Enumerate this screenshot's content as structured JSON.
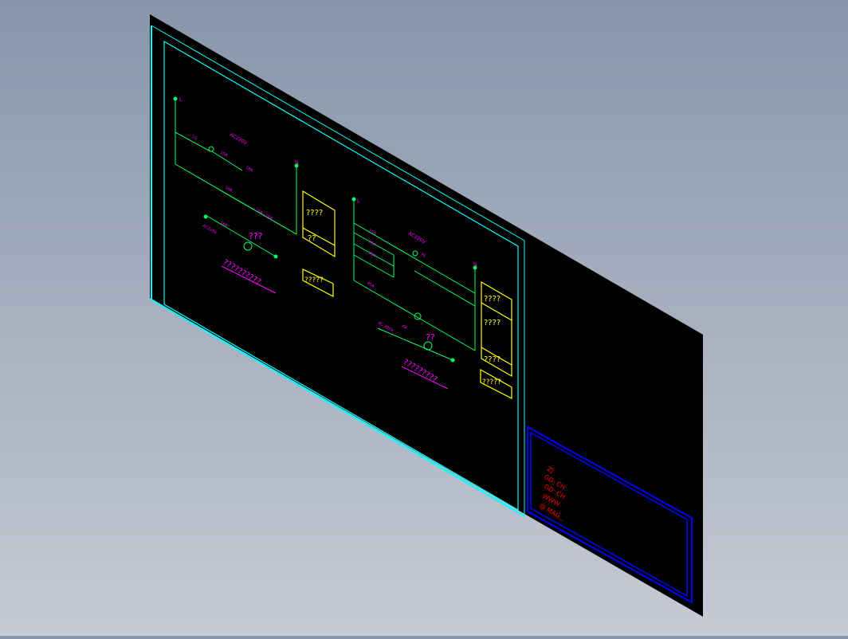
{
  "viewport": {
    "background_top": "#8796aa",
    "background_bottom": "#c6cad3",
    "sheet_color": "#000000"
  },
  "colors": {
    "frame": "#00ffff",
    "wire": "#00ff66",
    "label": "#ff00ff",
    "box": "#ffff00",
    "title_block": "#0000ff",
    "title_text": "#ff0000"
  },
  "left_circuit": {
    "phase_label": "L",
    "neutral_label": "N",
    "voltage": "AC220V",
    "breaker_label": "1Q",
    "switch_label": "1SA",
    "relay_label": "1KA",
    "relay_contact_label": "1KA",
    "lamp_circuit_label": "1KA",
    "meter_label": "1RA~1RB",
    "controller_label": "AC220V",
    "component_mark": "???",
    "box_upper": "????",
    "box_lower": "??",
    "box_tag": "?????",
    "caption": "??????????"
  },
  "right_circuit": {
    "phase_label": "L",
    "neutral_label": "N",
    "voltage": "AC220V",
    "contact_labels": [
      "1SA",
      "2SA",
      "3SA",
      "4SA"
    ],
    "lamp_label": "HL",
    "relay_label": "KA",
    "source_label": "AC 380V",
    "component_mark": "??",
    "box_upper": "????",
    "box_middle": "????",
    "box_lower": "????",
    "box_tag": "?????",
    "caption": "?????????"
  },
  "title_block": {
    "lines": [
      "ZJ",
      "GD: CH",
      "GD: CH",
      "WWW",
      "@ MAG",
      "—"
    ]
  }
}
